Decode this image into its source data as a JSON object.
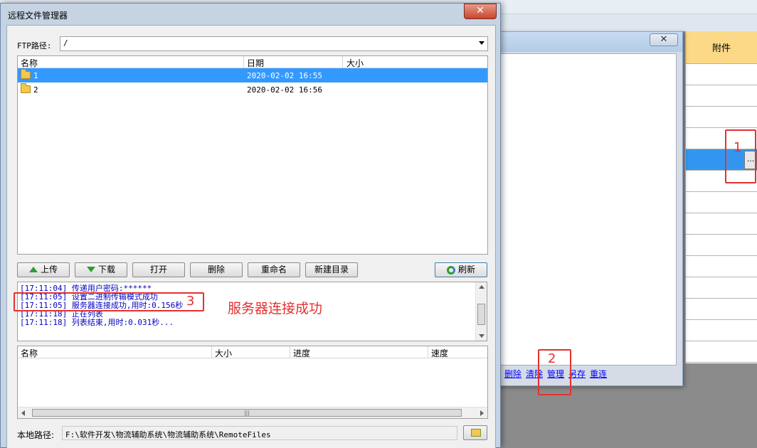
{
  "background": {
    "grid_header": "附件",
    "subwindow_close": "✕",
    "subwindow_links": [
      "删除",
      "清除",
      "管理",
      "另存",
      "重连"
    ],
    "ellipsis": "..."
  },
  "dialog": {
    "title": "远程文件管理器",
    "close": "✕",
    "ftp_label": "FTP路径:",
    "ftp_path": "/",
    "remote_list": {
      "columns": [
        "名称",
        "日期",
        "大小"
      ],
      "rows": [
        {
          "name": "1",
          "date": "2020-02-02 16:55",
          "size": ""
        },
        {
          "name": "2",
          "date": "2020-02-02 16:56",
          "size": ""
        }
      ]
    },
    "buttons": {
      "upload": "上传",
      "download": "下载",
      "open": "打开",
      "delete": "删除",
      "rename": "重命名",
      "new_dir": "新建目录",
      "refresh": "刷新"
    },
    "log": [
      "[17:11:04] 传递用户密码:******",
      "[17:11:05] 设置二进制传输模式成功",
      "[17:11:05] 服务器连接成功,用时:0.156秒",
      "[17:11:18] 正在列表",
      "[17:11:18] 列表结束,用时:0.031秒..."
    ],
    "transfer_list": {
      "columns": [
        "名称",
        "大小",
        "进度",
        "速度"
      ]
    },
    "local_label": "本地路径:",
    "local_path": "F:\\软件开发\\物流辅助系统\\物流辅助系统\\RemoteFiles"
  },
  "annotations": {
    "num1": "1",
    "num2": "2",
    "num3": "3",
    "note": "服务器连接成功"
  },
  "colors": {
    "annotation": "#e53030",
    "selection": "#3399ff",
    "log_text": "#0000c0"
  }
}
